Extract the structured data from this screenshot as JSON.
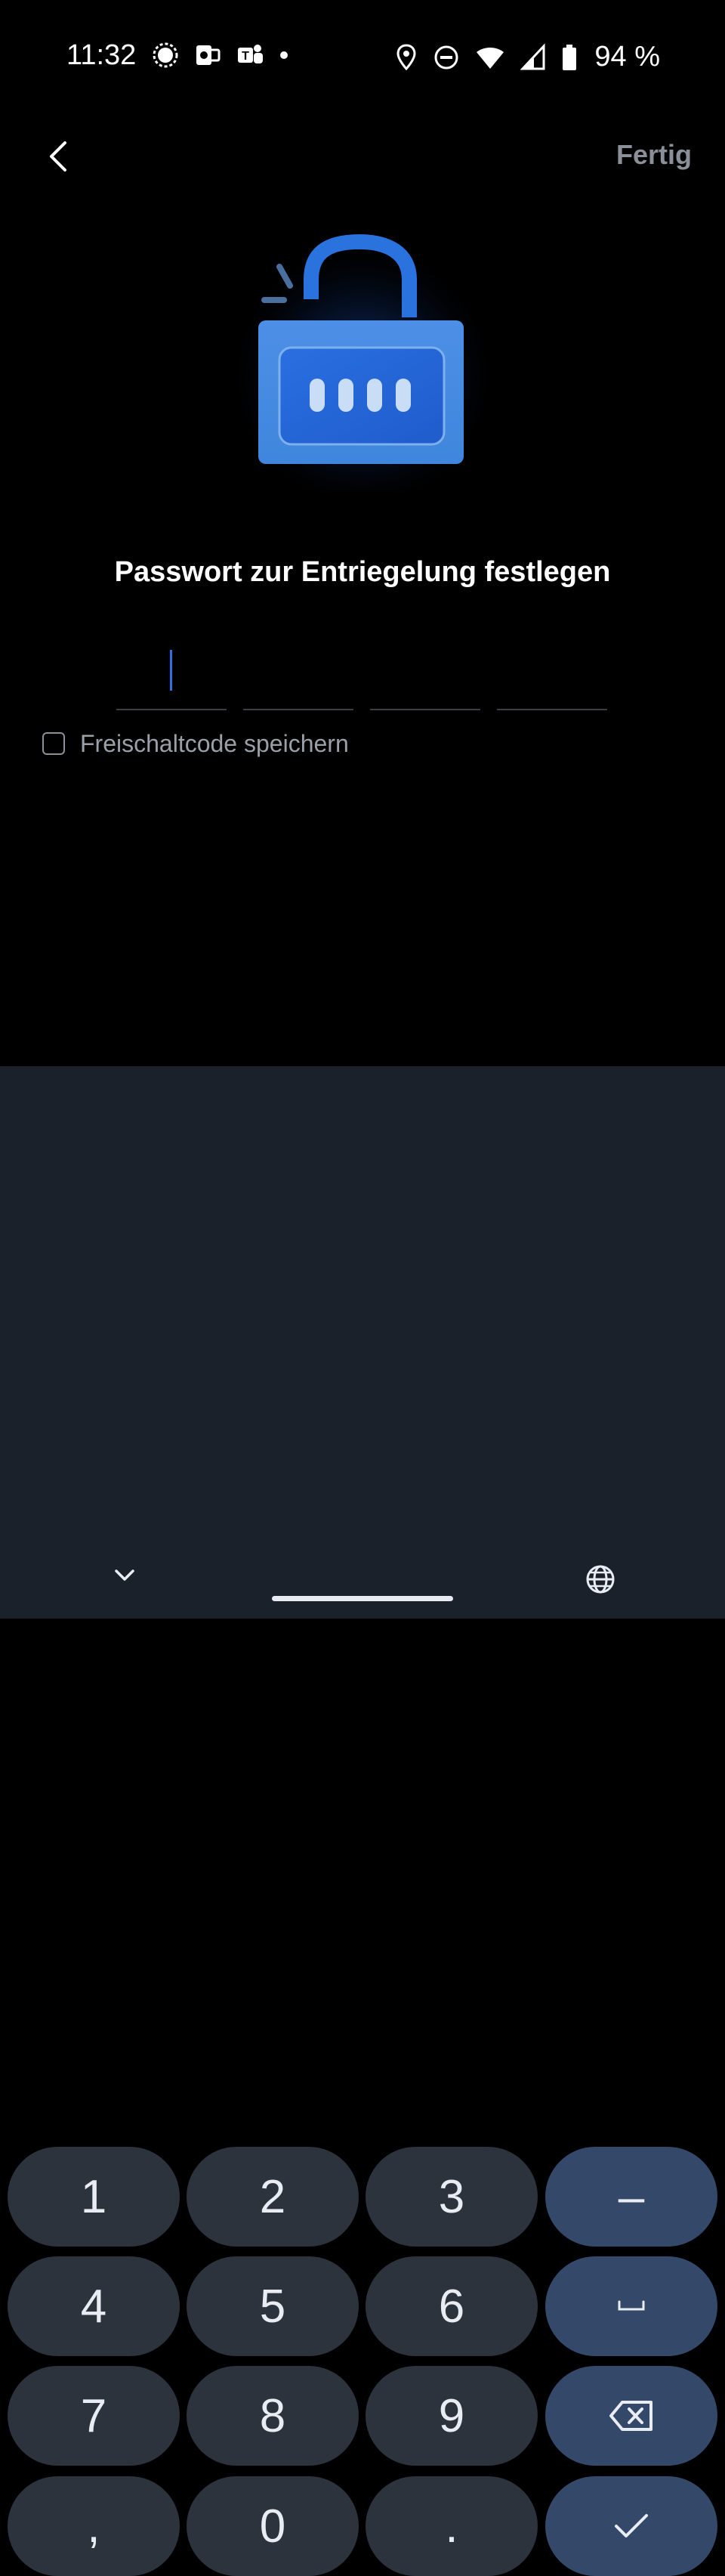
{
  "status_bar": {
    "time": "11:32",
    "battery_percent": "94 %",
    "left_icons": [
      "signal-messenger-icon",
      "outlook-icon",
      "teams-icon",
      "dot-icon"
    ],
    "right_icons": [
      "location-icon",
      "do-not-disturb-icon",
      "wifi-icon",
      "cell-signal-icon",
      "battery-icon"
    ]
  },
  "top_bar": {
    "done_label": "Fertig"
  },
  "title": "Passwort zur Entriegelung festlegen",
  "pin": {
    "slot_count": 4,
    "accent_color": "#2f6fe4"
  },
  "save_code": {
    "label": "Freischaltcode speichern",
    "checked": false
  },
  "keyboard": {
    "keys": {
      "k1": "1",
      "k2": "2",
      "k3": "3",
      "dash": "–",
      "k4": "4",
      "k5": "5",
      "k6": "6",
      "space": "␣",
      "k7": "7",
      "k8": "8",
      "k9": "9",
      "comma": ",",
      "k0": "0",
      "period": "."
    },
    "function_key_color": "#34496a",
    "key_color": "#2c333d"
  }
}
